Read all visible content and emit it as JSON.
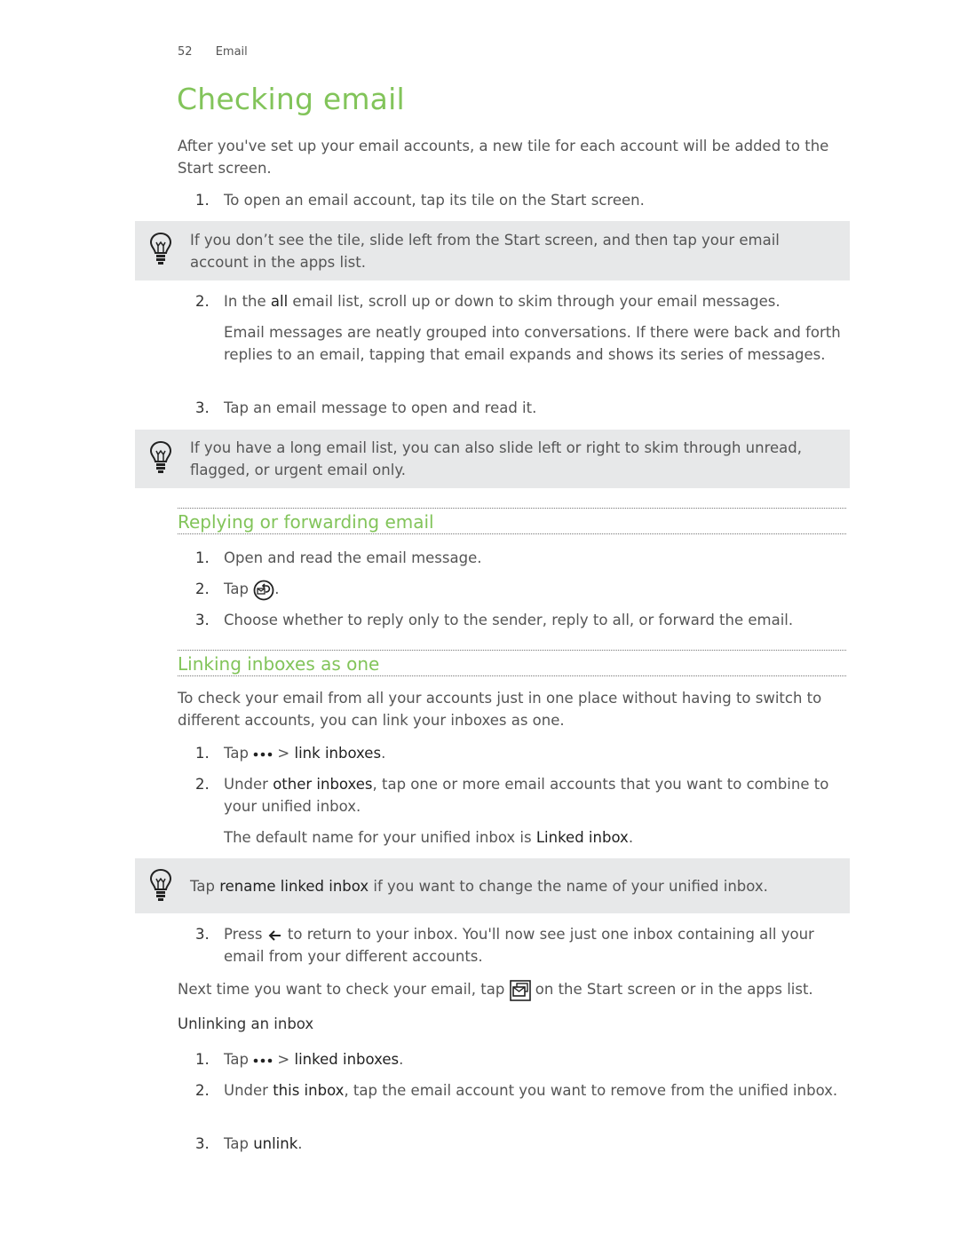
{
  "header": {
    "page_number": "52",
    "section": "Email"
  },
  "title": "Checking email",
  "intro": "After you've set up your email accounts, a new tile for each account will be added to the Start screen.",
  "checking_steps": [
    {
      "num": "1.",
      "text": "To open an email account, tap its tile on the Start screen."
    },
    {
      "num": "2.",
      "pre": "In the ",
      "bold": "all",
      "post": " email list, scroll up or down to skim through your email messages.",
      "sub": "Email messages are neatly grouped into conversations. If there were back and forth replies to an email, tapping that email expands and shows its series of messages."
    },
    {
      "num": "3.",
      "text": "Tap an email message to open and read it."
    }
  ],
  "tips": [
    {
      "icon": "lightbulb-icon",
      "text": "If you don’t see the tile, slide left from the Start screen, and then tap your email account in the apps list."
    },
    {
      "icon": "lightbulb-icon",
      "text": "If you have a long email list, you can also slide left or right to skim through unread, flagged, or urgent email only."
    },
    {
      "icon": "lightbulb-icon",
      "pre": "Tap ",
      "bold": "rename linked inbox",
      "post": " if you want to change the name of your unified inbox."
    }
  ],
  "replying": {
    "heading": "Replying or forwarding email",
    "steps": [
      {
        "num": "1.",
        "text": "Open and read the email message."
      },
      {
        "num": "2.",
        "pre": "Tap ",
        "icon": "reply-icon",
        "post": "."
      },
      {
        "num": "3.",
        "text": "Choose whether to reply only to the sender, reply to all, or forward the email."
      }
    ]
  },
  "linking": {
    "heading": "Linking inboxes as one",
    "intro": "To check your email from all your accounts just in one place without having to switch to different accounts, you can link your inboxes as one.",
    "steps": [
      {
        "num": "1.",
        "pre": "Tap ",
        "icon": "more-icon",
        "mid": " > ",
        "bold": "link inboxes",
        "post": "."
      },
      {
        "num": "2.",
        "pre": "Under ",
        "bold": "other inboxes",
        "post": ", tap one or more email accounts that you want to combine to your unified inbox.",
        "sub_pre": "The default name for your unified inbox is ",
        "sub_bold": "Linked inbox",
        "sub_post": "."
      },
      {
        "num": "3.",
        "pre": "Press ",
        "icon": "back-icon",
        "post": " to return to your inbox. You'll now see just one inbox containing all your email from your different accounts."
      }
    ],
    "next_pre": "Next time you want to check your email, tap ",
    "next_icon": "linked-inbox-icon",
    "next_post": " on the Start screen or in the apps list."
  },
  "unlinking": {
    "heading": "Unlinking an inbox",
    "steps": [
      {
        "num": "1.",
        "pre": "Tap ",
        "icon": "more-icon",
        "mid": " > ",
        "bold": "linked inboxes",
        "post": "."
      },
      {
        "num": "2.",
        "pre": "Under ",
        "bold": "this inbox",
        "post": ", tap the email account you want to remove from the unified inbox."
      },
      {
        "num": "3.",
        "pre": "Tap ",
        "bold": "unlink",
        "post": "."
      }
    ]
  },
  "colors": {
    "accent": "#82c45a",
    "tip_bg": "#e7e8e9",
    "text": "#555555"
  }
}
